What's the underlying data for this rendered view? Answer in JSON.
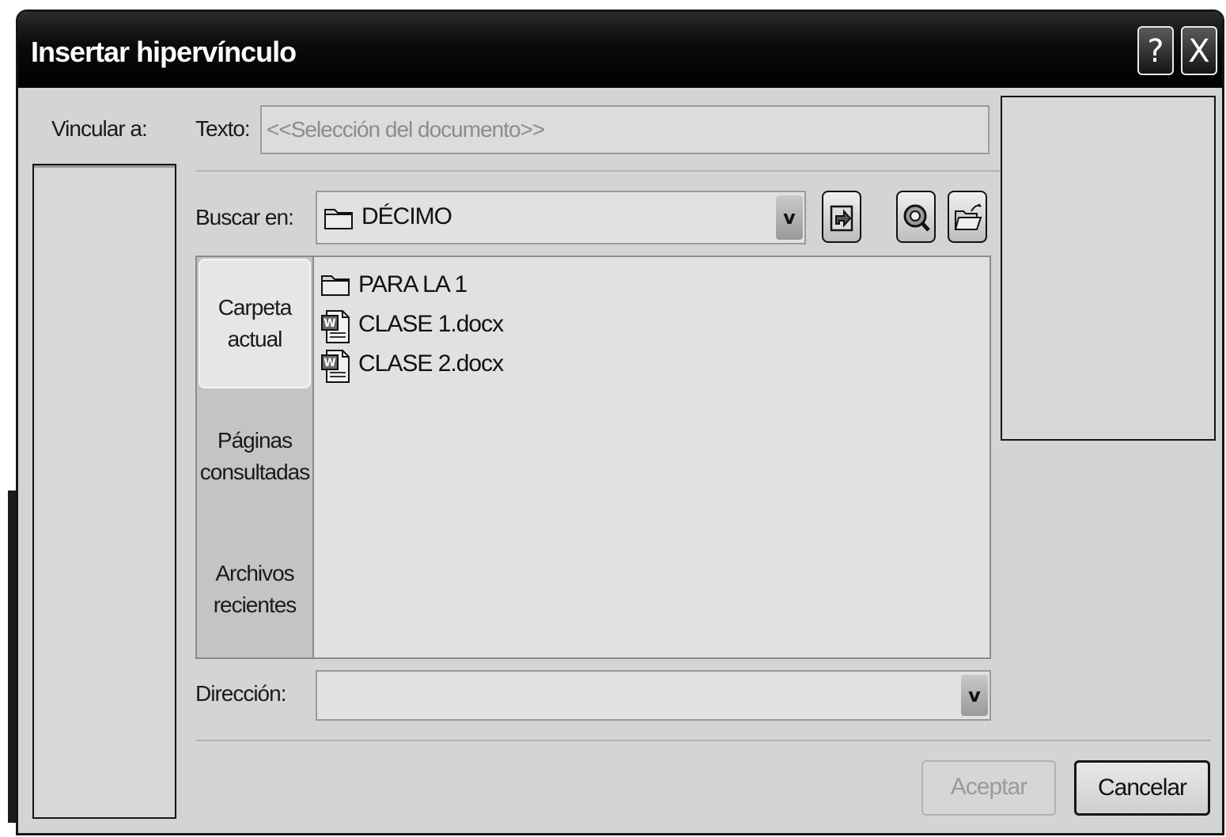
{
  "dialog": {
    "title": "Insertar hipervínculo",
    "help_label": "?",
    "close_label": "X"
  },
  "link_to": {
    "label": "Vincular a:"
  },
  "text_field": {
    "label": "Texto:",
    "value": "<<Selección del documento>>"
  },
  "look_in": {
    "label": "Buscar en:",
    "value": "DÉCIMO",
    "arrow": "v"
  },
  "places": [
    {
      "line1": "Carpeta",
      "line2": "actual"
    },
    {
      "line1": "Páginas",
      "line2": "consultadas"
    },
    {
      "line1": "Archivos",
      "line2": "recientes"
    }
  ],
  "files": [
    {
      "name": "PARA LA 1",
      "icon": "folder-icon"
    },
    {
      "name": "CLASE 1.docx",
      "icon": "word-document-icon"
    },
    {
      "name": "CLASE 2.docx",
      "icon": "word-document-icon"
    }
  ],
  "address": {
    "label": "Dirección:",
    "value": "",
    "arrow": "v"
  },
  "buttons": {
    "ok": "Aceptar",
    "cancel": "Cancelar"
  },
  "toolbar_icons": [
    "up-one-folder-icon",
    "browse-web-icon",
    "browse-file-icon"
  ]
}
